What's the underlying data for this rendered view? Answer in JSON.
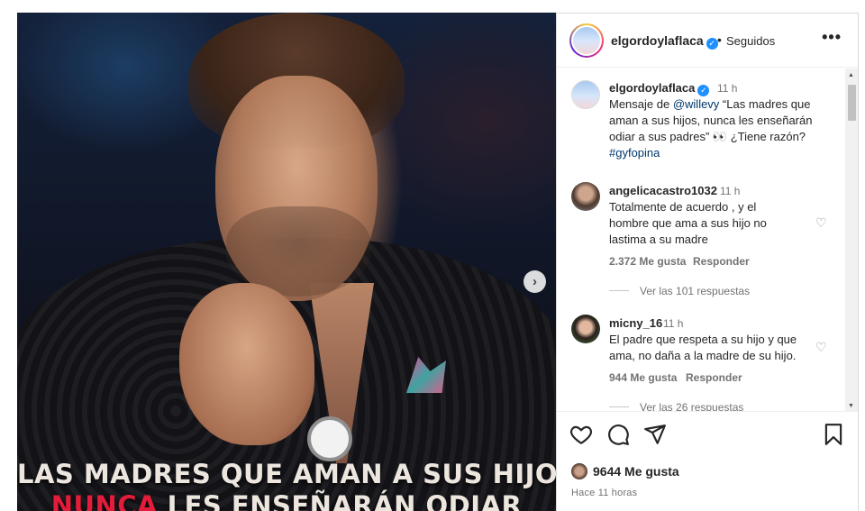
{
  "post": {
    "caption_line1": "LAS MADRES QUE AMAN A SUS HIJOS",
    "caption_line2_accent": "NUNCA",
    "caption_line2_rest": " LES ENSEÑARÁN ODIAR"
  },
  "header": {
    "username": "elgordoylaflaca",
    "separator": "•",
    "follow_status": "Seguidos",
    "more_label": "•••"
  },
  "owner_comment": {
    "username": "elgordoylaflaca",
    "time": "11 h",
    "text_prefix": "Mensaje de ",
    "mention": "@willevy",
    "text_body": " “Las madres que aman a sus hijos, nunca les enseñarán odiar a sus padres” 👀 ¿Tiene razón? ",
    "hashtag": "#gyfopina"
  },
  "comments": [
    {
      "username": "angelicacastro1032",
      "time": "11 h",
      "text": "Totalmente de acuerdo , y el hombre que ama a sus hijo no lastima a su madre",
      "likes": "2.372 Me gusta",
      "reply_label": "Responder",
      "view_replies": "Ver las 101 respuestas"
    },
    {
      "username": "micny_16",
      "time": "11 h",
      "text": "El padre que respeta a su hijo y que ama, no daña a la madre de su hijo.",
      "likes": "944 Me gusta",
      "reply_label": "Responder",
      "view_replies": "Ver las 26 respuestas"
    }
  ],
  "actions": {
    "like_count": "9644 Me gusta",
    "posted_time": "Hace 11 horas"
  },
  "icons": {
    "verified": "verified-badge-icon",
    "heart": "heart-icon",
    "comment": "comment-icon",
    "share": "share-icon",
    "save": "bookmark-icon",
    "next": "chevron-right-icon"
  },
  "colors": {
    "verified_blue": "#1e90ff",
    "link_blue": "#00376b",
    "caption_accent": "#e31c3a",
    "muted_text": "#737373"
  }
}
